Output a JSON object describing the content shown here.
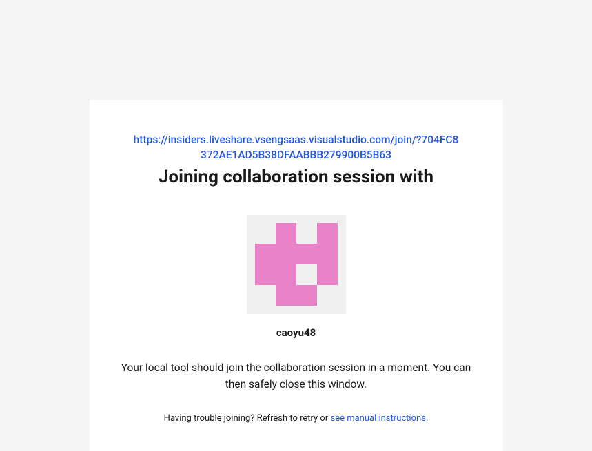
{
  "join_url": "https://insiders.liveshare.vsengsaas.visualstudio.com/join/?704FC8372AE1AD5B38DFAABBB279900B5B63",
  "heading": "Joining collaboration session with",
  "username": "caoyu48",
  "status_message": "Your local tool should join the collaboration session in a moment. You can then safely close this window.",
  "trouble_prefix": "Having trouble joining? Refresh to retry or ",
  "trouble_link_text": "see manual instructions.",
  "avatar": {
    "bg": "#f0f0f0",
    "color": "#e783c6"
  }
}
